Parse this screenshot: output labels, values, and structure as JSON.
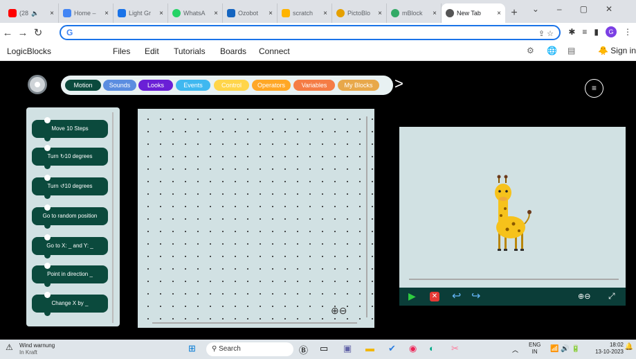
{
  "browser": {
    "tabs": [
      {
        "title": "(28",
        "color": "#ff0000"
      },
      {
        "title": "Home –",
        "color": "#4285f4"
      },
      {
        "title": "Light Gr",
        "color": "#1a73e8"
      },
      {
        "title": "WhatsA",
        "color": "#25d366"
      },
      {
        "title": "Ozobot",
        "color": "#1565c0"
      },
      {
        "title": "scratch",
        "color": "#ffb400"
      },
      {
        "title": "PictoBlo",
        "color": "#e5a000"
      },
      {
        "title": "mBlock",
        "color": "#3a6"
      },
      {
        "title": "New Tab",
        "color": "#555"
      }
    ],
    "address": "G"
  },
  "app": {
    "name": "LogicBlocks",
    "menu": [
      "Files",
      "Edit",
      "Tutorials",
      "Boards",
      "Connect"
    ],
    "sign_in": "Sign in"
  },
  "categories": [
    {
      "label": "Motion",
      "color": "#0b4a3d"
    },
    {
      "label": "Sounds",
      "color": "#5b8de0"
    },
    {
      "label": "Looks",
      "color": "#6a1fd6"
    },
    {
      "label": "Events",
      "color": "#3fb8f0"
    },
    {
      "label": "Control",
      "color": "#ffd54a"
    },
    {
      "label": "Operators",
      "color": "#ffa726"
    },
    {
      "label": "Variables",
      "color": "#f57c45"
    },
    {
      "label": "My Blocks",
      "color": "#e8a84a"
    }
  ],
  "blocks": [
    "Move 10 Steps",
    "Turn ↻10 degrees",
    "Turn ↺10 degrees",
    "Go to random position",
    "Go to X: _ and Y: _",
    "Point in direction _",
    "Change X by _"
  ],
  "taskbar": {
    "weather_title": "Wind warnung",
    "weather_sub": "In Kraft",
    "search": "Search",
    "lang1": "ENG",
    "lang2": "IN",
    "time": "18:02",
    "date": "13-10-2023"
  }
}
